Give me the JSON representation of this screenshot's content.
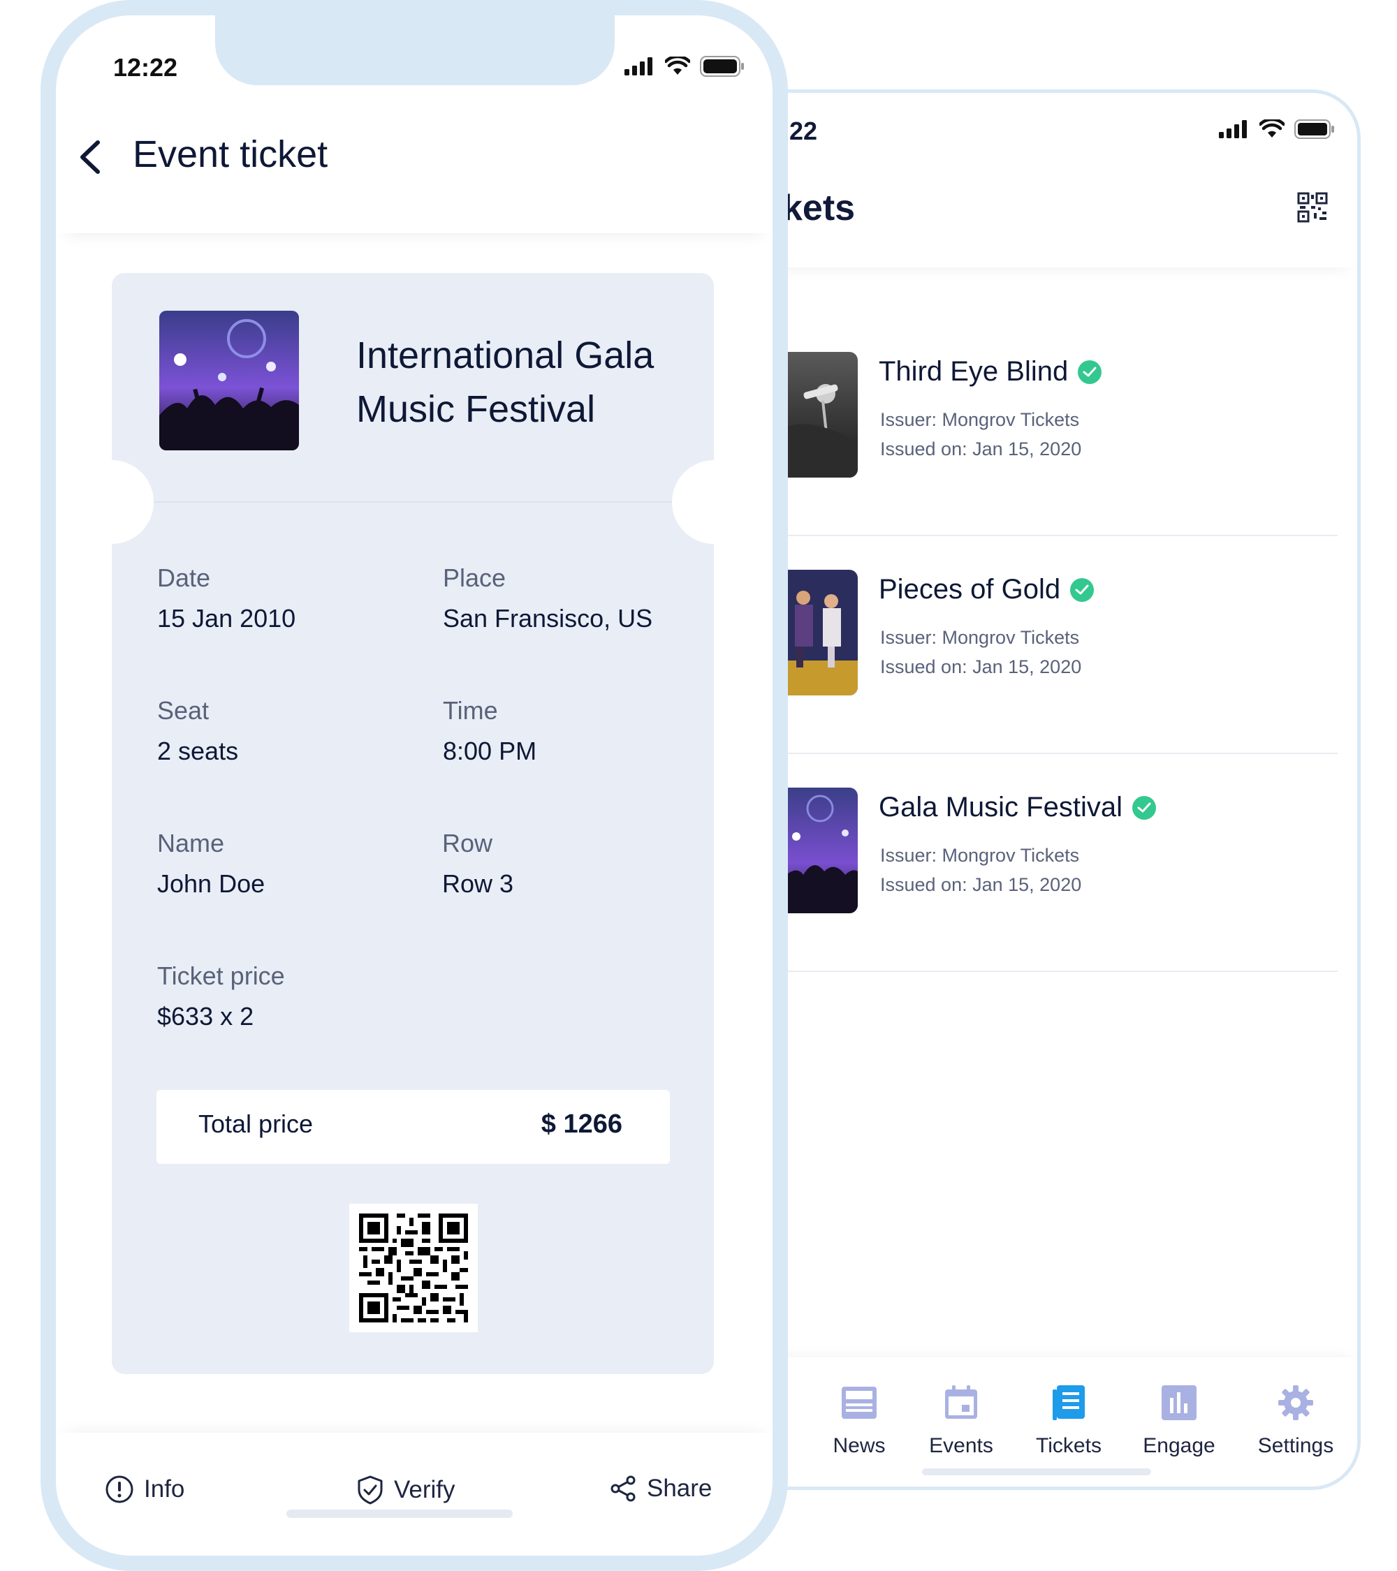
{
  "back_screen": {
    "status": {
      "time": ":22"
    },
    "header": {
      "title": "kets",
      "qr_icon": "qr-code-icon"
    },
    "tickets": [
      {
        "title": "Third Eye Blind",
        "issuer": "Issuer: Mongrov Tickets",
        "issued": "Issued on: Jan 15, 2020",
        "verified": true
      },
      {
        "title": "Pieces of Gold",
        "issuer": "Issuer: Mongrov Tickets",
        "issued": "Issued on: Jan 15, 2020",
        "verified": true
      },
      {
        "title": "Gala Music Festival",
        "issuer": "Issuer: Mongrov Tickets",
        "issued": "Issued on: Jan 15, 2020",
        "verified": true
      }
    ],
    "tabs": [
      {
        "label": "News",
        "icon": "news-icon",
        "active": false
      },
      {
        "label": "Events",
        "icon": "calendar-icon",
        "active": false
      },
      {
        "label": "Tickets",
        "icon": "tickets-icon",
        "active": true
      },
      {
        "label": "Engage",
        "icon": "chart-icon",
        "active": false
      },
      {
        "label": "Settings",
        "icon": "gear-icon",
        "active": false
      }
    ]
  },
  "front_screen": {
    "status": {
      "time": "12:22"
    },
    "header": {
      "title": "Event ticket"
    },
    "ticket": {
      "event_name": "International Gala Music Festival",
      "fields": {
        "date": {
          "label": "Date",
          "value": "15 Jan 2010"
        },
        "place": {
          "label": "Place",
          "value": "San Fransisco, US"
        },
        "seat": {
          "label": "Seat",
          "value": "2 seats"
        },
        "time": {
          "label": "Time",
          "value": "8:00 PM"
        },
        "name": {
          "label": "Name",
          "value": "John Doe"
        },
        "row": {
          "label": "Row",
          "value": "Row 3"
        },
        "price": {
          "label": "Ticket price",
          "value": "$633 x 2"
        }
      },
      "total": {
        "label": "Total price",
        "value": "$ 1266"
      }
    },
    "actions": [
      {
        "label": "Info",
        "icon": "info-icon"
      },
      {
        "label": "Verify",
        "icon": "shield-check-icon"
      },
      {
        "label": "Share",
        "icon": "share-icon"
      }
    ]
  },
  "colors": {
    "ink": "#0e1836",
    "muted": "#5a627a",
    "ticket_bg": "#e9edf5",
    "frame": "#d9e8f5",
    "verified": "#33c88f",
    "tab_active": "#1e9be9",
    "tab_inactive": "#a9b1e2"
  }
}
